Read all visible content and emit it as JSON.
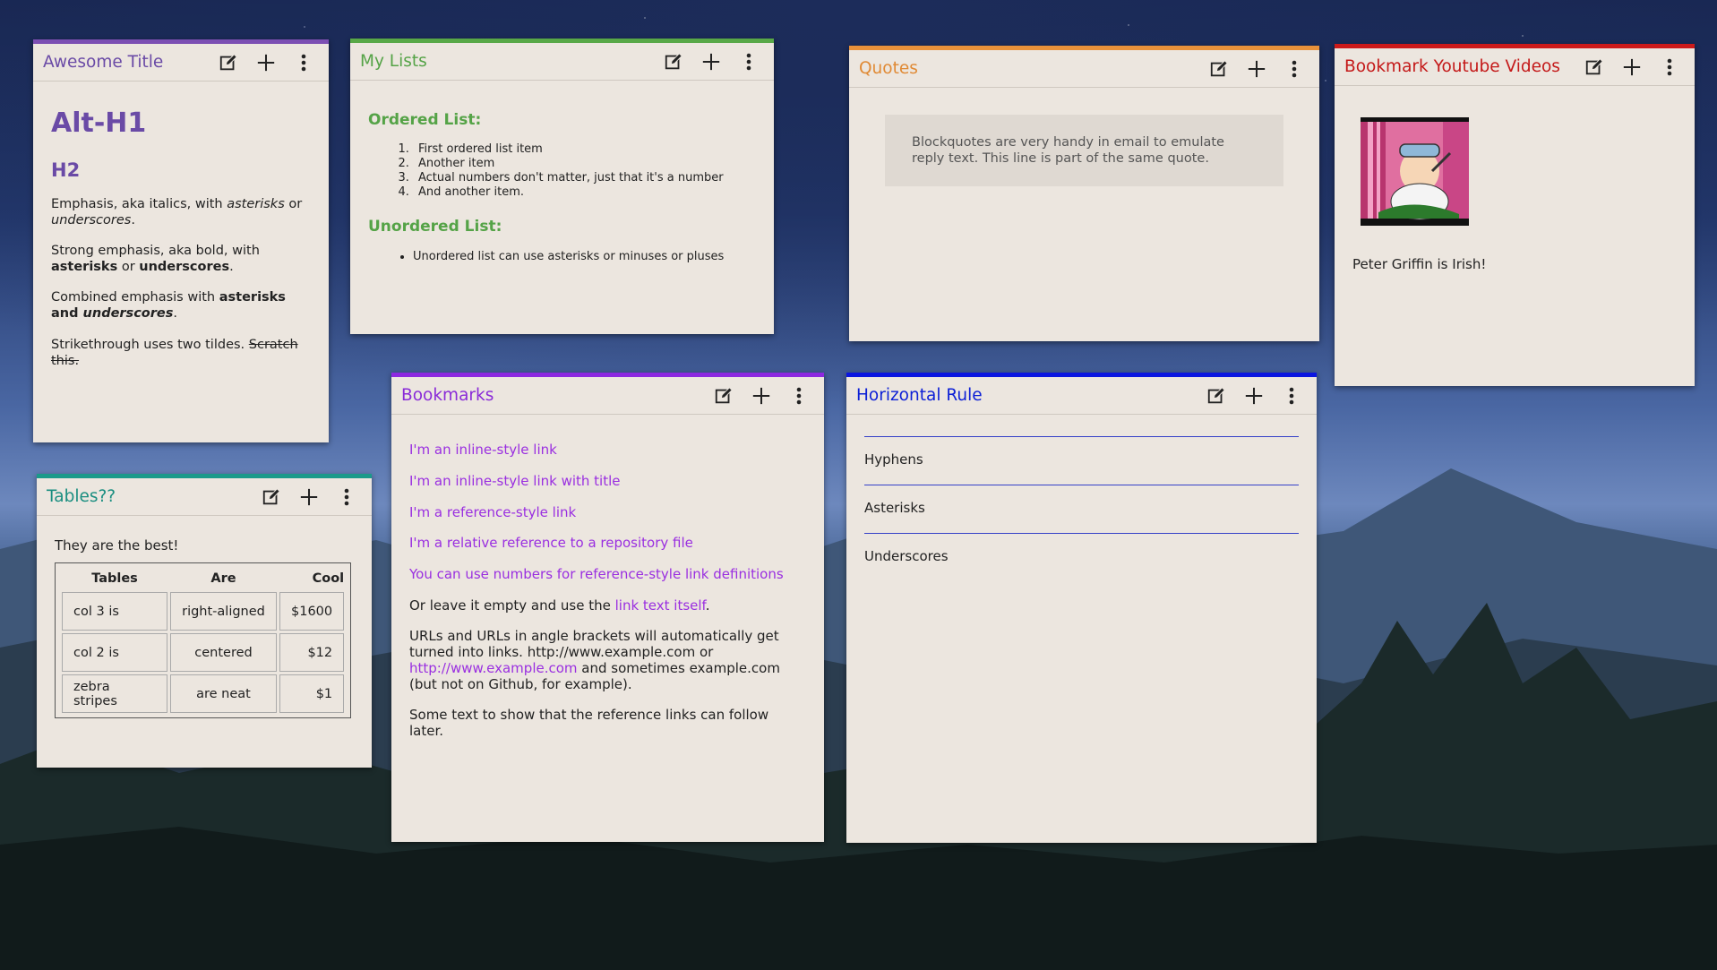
{
  "cards": {
    "awesome": {
      "title": "Awesome Title",
      "h1": "Alt-H1",
      "h2": "H2",
      "p1_a": "Emphasis, aka italics, with ",
      "p1_b": "asterisks",
      "p1_c": " or ",
      "p1_d": "underscores",
      "p1_e": ".",
      "p2_a": "Strong emphasis, aka bold, with ",
      "p2_b": "asterisks",
      "p2_c": " or ",
      "p2_d": "underscores",
      "p2_e": ".",
      "p3_a": "Combined emphasis with ",
      "p3_b": "asterisks and ",
      "p3_c": "underscores",
      "p3_d": ".",
      "p4_a": "Strikethrough uses two tildes. ",
      "p4_b": "Scratch this."
    },
    "lists": {
      "title": "My Lists",
      "ordered_heading": "Ordered List:",
      "ordered_items": [
        "First ordered list item",
        "Another item",
        "Actual numbers don't matter, just that it's a number",
        "And another item."
      ],
      "unordered_heading": "Unordered List:",
      "unordered_items": [
        "Unordered list can use asterisks or minuses or pluses"
      ]
    },
    "quotes": {
      "title": "Quotes",
      "quote": "Blockquotes are very handy in email to emulate reply text. This line is part of the same quote."
    },
    "youtube": {
      "title": "Bookmark Youtube Videos",
      "caption": "Peter Griffin is Irish!"
    },
    "tables": {
      "title": "Tables??",
      "intro": "They are the best!",
      "headers": [
        "Tables",
        "Are",
        "Cool"
      ],
      "rows": [
        [
          "col 3 is",
          "right-aligned",
          "$1600"
        ],
        [
          "col 2 is",
          "centered",
          "$12"
        ],
        [
          "zebra stripes",
          "are neat",
          "$1"
        ]
      ]
    },
    "bookmarks": {
      "title": "Bookmarks",
      "links": [
        "I'm an inline-style link",
        "I'm an inline-style link with title",
        "I'm a reference-style link",
        "I'm a relative reference to a repository file",
        "You can use numbers for reference-style link definitions"
      ],
      "p_empty_a": "Or leave it empty and use the ",
      "p_empty_link": "link text itself",
      "p_empty_b": ".",
      "p_urls_a": "URLs and URLs in angle brackets will automatically get turned into links. http://www.example.com or ",
      "p_urls_link": "http://www.example.com",
      "p_urls_b": " and sometimes example.com (but not on Github, for example).",
      "p_ref": "Some text to show that the reference links can follow later."
    },
    "hr": {
      "title": "Horizontal Rule",
      "lines": [
        "Hyphens",
        "Asterisks",
        "Underscores"
      ]
    }
  },
  "icons": {
    "edit": "edit-icon",
    "add": "plus-icon",
    "menu": "more-vertical-icon"
  },
  "colors": {
    "awesome": "#7c4fb3",
    "lists": "#58a847",
    "quotes": "#e8913a",
    "youtube": "#cc1a1a",
    "tables": "#1a9a8a",
    "bookmarks": "#8c28e0",
    "hr": "#0b16e0",
    "card_bg": "#ece6df"
  }
}
